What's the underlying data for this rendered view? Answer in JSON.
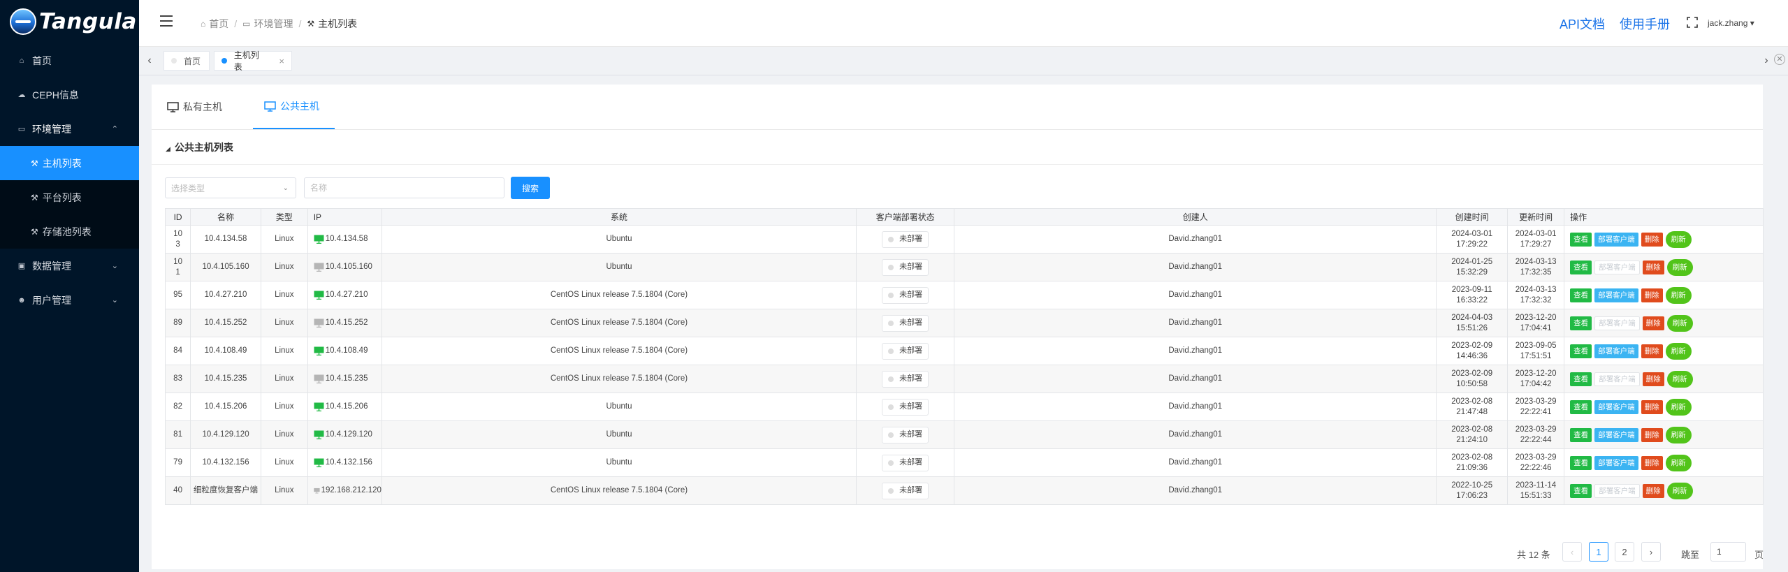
{
  "sidebar": {
    "logo_text": "Tangula",
    "items": [
      {
        "label": "首页",
        "icon": "home-icon",
        "glyph": "⌂"
      },
      {
        "label": "CEPH信息",
        "icon": "cloud-icon",
        "glyph": "☁"
      },
      {
        "label": "环境管理",
        "icon": "monitor-icon",
        "glyph": "▭",
        "arrow": "⌃"
      }
    ],
    "sub_items": [
      {
        "label": "主机列表",
        "icon": "hammer-icon",
        "glyph": "⚒"
      },
      {
        "label": "平台列表",
        "icon": "hammer-icon",
        "glyph": "⚒"
      },
      {
        "label": "存储池列表",
        "icon": "hammer-icon",
        "glyph": "⚒"
      }
    ],
    "items_after": [
      {
        "label": "数据管理",
        "icon": "lock-icon",
        "glyph": "▣",
        "arrow": "⌄"
      },
      {
        "label": "用户管理",
        "icon": "user-icon",
        "glyph": "☻",
        "arrow": "⌄"
      }
    ]
  },
  "header": {
    "breadcrumb": [
      "首页",
      "环境管理",
      "主机列表"
    ],
    "breadcrumb_sep": "/",
    "api_docs": "API文档",
    "manual": "使用手册",
    "user": "jack.zhang ▾"
  },
  "page_tabs": [
    {
      "label": "首页",
      "dot_color": "#e8e8e8"
    },
    {
      "label": "主机列表",
      "dot_color": "#1890ff",
      "close": "×"
    }
  ],
  "tab_arrows": {
    "left": "‹",
    "right": "›",
    "close_all": "✕"
  },
  "host_tabs": {
    "private": "私有主机",
    "public": "公共主机"
  },
  "section_title": "公共主机列表",
  "filters": {
    "type_placeholder": "选择类型",
    "name_placeholder": "名称",
    "search_label": "搜索"
  },
  "table": {
    "headers": [
      "ID",
      "名称",
      "类型",
      "IP",
      "系统",
      "客户端部署状态",
      "创建人",
      "创建时间",
      "更新时间",
      "操作"
    ],
    "actions": {
      "view": "查看",
      "deploy": "部署客户端",
      "delete": "删除",
      "refresh": "刷新"
    },
    "status_text": "未部署",
    "rows": [
      {
        "id": "10\n3",
        "name": "10.4.134.58",
        "type": "Linux",
        "ip": "10.4.134.58",
        "online": true,
        "os": "Ubuntu",
        "creator": "David.zhang01",
        "created": "2024-03-01\n17:29:22",
        "updated": "2024-03-01\n17:29:27",
        "deploy_enabled": true
      },
      {
        "id": "10\n1",
        "name": "10.4.105.160",
        "type": "Linux",
        "ip": "10.4.105.160",
        "online": false,
        "os": "Ubuntu",
        "creator": "David.zhang01",
        "created": "2024-01-25\n15:32:29",
        "updated": "2024-03-13\n17:32:35",
        "deploy_enabled": false
      },
      {
        "id": "95",
        "name": "10.4.27.210",
        "type": "Linux",
        "ip": "10.4.27.210",
        "online": true,
        "os": "CentOS Linux release 7.5.1804 (Core)",
        "creator": "David.zhang01",
        "created": "2023-09-11\n16:33:22",
        "updated": "2024-03-13\n17:32:32",
        "deploy_enabled": true
      },
      {
        "id": "89",
        "name": "10.4.15.252",
        "type": "Linux",
        "ip": "10.4.15.252",
        "online": false,
        "os": "CentOS Linux release 7.5.1804 (Core)",
        "creator": "David.zhang01",
        "created": "2024-04-03\n15:51:26",
        "updated": "2023-12-20\n17:04:41",
        "deploy_enabled": false
      },
      {
        "id": "84",
        "name": "10.4.108.49",
        "type": "Linux",
        "ip": "10.4.108.49",
        "online": true,
        "os": "CentOS Linux release 7.5.1804 (Core)",
        "creator": "David.zhang01",
        "created": "2023-02-09\n14:46:36",
        "updated": "2023-09-05\n17:51:51",
        "deploy_enabled": true
      },
      {
        "id": "83",
        "name": "10.4.15.235",
        "type": "Linux",
        "ip": "10.4.15.235",
        "online": false,
        "os": "CentOS Linux release 7.5.1804 (Core)",
        "creator": "David.zhang01",
        "created": "2023-02-09\n10:50:58",
        "updated": "2023-12-20\n17:04:42",
        "deploy_enabled": false
      },
      {
        "id": "82",
        "name": "10.4.15.206",
        "type": "Linux",
        "ip": "10.4.15.206",
        "online": true,
        "os": "Ubuntu",
        "creator": "David.zhang01",
        "created": "2023-02-08\n21:47:48",
        "updated": "2023-03-29\n22:22:41",
        "deploy_enabled": true
      },
      {
        "id": "81",
        "name": "10.4.129.120",
        "type": "Linux",
        "ip": "10.4.129.120",
        "online": true,
        "os": "Ubuntu",
        "creator": "David.zhang01",
        "created": "2023-02-08\n21:24:10",
        "updated": "2023-03-29\n22:22:44",
        "deploy_enabled": true
      },
      {
        "id": "79",
        "name": "10.4.132.156",
        "type": "Linux",
        "ip": "10.4.132.156",
        "online": true,
        "os": "Ubuntu",
        "creator": "David.zhang01",
        "created": "2023-02-08\n21:09:36",
        "updated": "2023-03-29\n22:22:46",
        "deploy_enabled": true
      },
      {
        "id": "40",
        "name": "细粒度恢复客户端",
        "type": "Linux",
        "ip": "192.168.212.120",
        "online": false,
        "os": "CentOS Linux release 7.5.1804 (Core)",
        "creator": "David.zhang01",
        "created": "2022-10-25\n17:06:23",
        "updated": "2023-11-14\n15:51:33",
        "deploy_enabled": false
      }
    ]
  },
  "pagination": {
    "total": "共 12 条",
    "prev": "‹",
    "next": "›",
    "pages": [
      "1",
      "2"
    ],
    "current": "1",
    "jump_label": "跳至",
    "jump_value": "1",
    "unit": "页"
  },
  "colors": {
    "accent": "#1890ff",
    "sidebar_bg": "#001529",
    "online_icon": "#21ba45",
    "offline_icon": "#b5b5b5"
  }
}
